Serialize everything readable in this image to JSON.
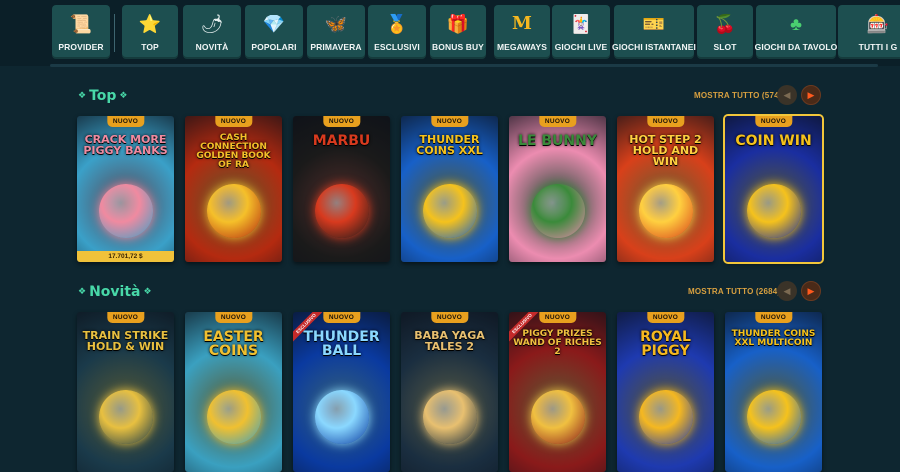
{
  "categories": [
    {
      "label": "PROVIDER",
      "icon": "scroll-icon",
      "glyph": "📜"
    },
    {
      "label": "TOP",
      "icon": "star-icon",
      "glyph": "⭐"
    },
    {
      "label": "NOVITÀ",
      "icon": "chili-icon",
      "glyph": "🌶"
    },
    {
      "label": "POPOLARI",
      "icon": "gem-icon",
      "glyph": "💎"
    },
    {
      "label": "PRIMAVERA",
      "icon": "butterfly-icon",
      "glyph": "🦋"
    },
    {
      "label": "ESCLUSIVI",
      "icon": "medal-icon",
      "glyph": "🏅"
    },
    {
      "label": "BONUS BUY",
      "icon": "gift-icon",
      "glyph": "🎁"
    },
    {
      "label": "MEGAWAYS",
      "icon": "m-icon",
      "glyph": "M"
    },
    {
      "label": "GIOCHI LIVE",
      "icon": "live-card-icon",
      "glyph": "🃏"
    },
    {
      "label": "GIOCHI ISTANTANEI",
      "icon": "scratch-card-icon",
      "glyph": "🎫"
    },
    {
      "label": "SLOT",
      "icon": "cherries-icon",
      "glyph": "🍒"
    },
    {
      "label": "GIOCHI DA TAVOLO",
      "icon": "clubs-icon",
      "glyph": "♣"
    },
    {
      "label": "TUTTI I G",
      "icon": "all-games-icon",
      "glyph": "🎰"
    }
  ],
  "sections": {
    "top": {
      "title": "Top",
      "show_all": "MOSTRA TUTTO (574)",
      "prev_icon": "chevron-left-icon",
      "next_icon": "chevron-right-icon",
      "games": [
        {
          "badge": "NUOVO",
          "name": "CRACK MORE PIGGY BANKS",
          "jackpot": "17.701,72 $",
          "bg": "#3aa0c8",
          "accent": "#f08aa0"
        },
        {
          "badge": "NUOVO",
          "name": "CASH CONNECTION GOLDEN BOOK OF RA",
          "bg": "#b42a10",
          "accent": "#f5c02a"
        },
        {
          "badge": "NUOVO",
          "name": "MARBU",
          "bg": "#1a1a1a",
          "accent": "#d83a1e"
        },
        {
          "badge": "NUOVO",
          "name": "THUNDER COINS XXL",
          "bg": "#1760c8",
          "accent": "#f5c21c"
        },
        {
          "badge": "NUOVO",
          "name": "LE BUNNY",
          "bg": "#ec8cb0",
          "accent": "#3a8a3a"
        },
        {
          "badge": "NUOVO",
          "name": "HOT STEP 2 HOLD AND WIN",
          "bg": "#d8401a",
          "accent": "#ffd040"
        },
        {
          "badge": "NUOVO",
          "name": "COIN WIN",
          "bg": "#1a2ea0",
          "accent": "#f5c21c"
        }
      ]
    },
    "novita": {
      "title": "Novità",
      "show_all": "MOSTRA TUTTO (2684)",
      "prev_icon": "chevron-left-icon",
      "next_icon": "chevron-right-icon",
      "games": [
        {
          "badge": "NUOVO",
          "name": "TRAIN STRIKE HOLD & WIN",
          "bg": "#1a3a4a",
          "accent": "#e8c040"
        },
        {
          "badge": "NUOVO",
          "name": "EASTER COINS",
          "bg": "#3aa0c0",
          "accent": "#f0c030"
        },
        {
          "badge": "NUOVO",
          "exclusive": "ESCLUSIVO",
          "name": "THUNDER BALL",
          "bg": "#0a3aa0",
          "accent": "#8ad8ff"
        },
        {
          "badge": "NUOVO",
          "name": "BABA YAGA TALES 2",
          "bg": "#1a2e40",
          "accent": "#e8c070"
        },
        {
          "badge": "NUOVO",
          "exclusive": "ESCLUSIVO",
          "name": "PIGGY PRIZES WAND OF RICHES 2",
          "bg": "#8a1a1a",
          "accent": "#f0c040"
        },
        {
          "badge": "NUOVO",
          "name": "ROYAL PIGGY",
          "bg": "#1e3ab0",
          "accent": "#f5b820"
        },
        {
          "badge": "NUOVO",
          "name": "THUNDER COINS XXL MULTICOIN",
          "bg": "#1760c8",
          "accent": "#f5c21c"
        }
      ]
    }
  }
}
